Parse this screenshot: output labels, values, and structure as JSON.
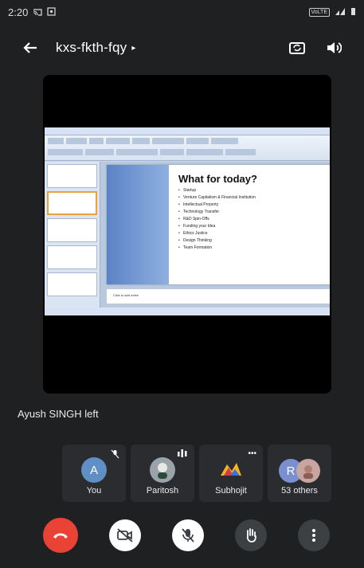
{
  "status_bar": {
    "time": "2:20",
    "network_badge": "VoLTE"
  },
  "app_bar": {
    "meeting_code": "kxs-fkth-fqy"
  },
  "slide": {
    "heading": "What for today?",
    "bullets": [
      "Startup",
      "Venture Capitalism & Financial Institution",
      "Intellectual Property",
      "Technology Transfer",
      "R&D Spin-Offs",
      "Funding your Idea",
      "Ethics Justice",
      "Design Thinking",
      "Team Formation"
    ],
    "notes_placeholder": "Click to add notes"
  },
  "toast": "Ayush SINGH left",
  "participants": [
    {
      "name": "You",
      "initial": "A",
      "color": "#5f8fc4",
      "corner": "mic-off-icon"
    },
    {
      "name": "Paritosh",
      "corner": "audio-level-icon"
    },
    {
      "name": "Subhojit",
      "corner": "more-icon"
    },
    {
      "name": "53 others",
      "initial": "R",
      "color": "#7a8fd0"
    }
  ],
  "colors": {
    "end_call": "#ea4335",
    "background": "#1f2022",
    "tile": "#2b2c2f"
  }
}
